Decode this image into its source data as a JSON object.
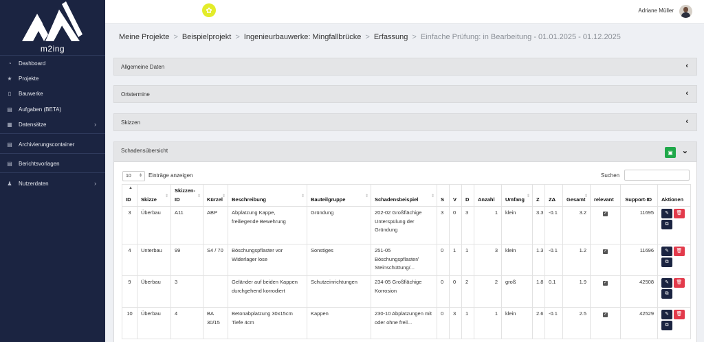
{
  "app": {
    "name": "m2ing"
  },
  "sidebar": {
    "items": [
      {
        "label": "Dashboard",
        "icon": "dashboard-icon"
      },
      {
        "label": "Projekte",
        "icon": "star-icon"
      },
      {
        "label": "Bauwerke",
        "icon": "building-icon"
      },
      {
        "label": "Aufgaben (BETA)",
        "icon": "tasks-icon"
      },
      {
        "label": "Datensätze",
        "icon": "records-icon",
        "has_submenu": true
      },
      {
        "label": "Archivierungscontainer",
        "icon": "archive-icon"
      },
      {
        "label": "Berichtsvorlagen",
        "icon": "report-icon"
      },
      {
        "label": "Nutzerdaten",
        "icon": "user-data-icon",
        "has_submenu": true
      }
    ]
  },
  "topbar": {
    "user_name": "Adriane Müller",
    "accent_color": "#e3ec2a"
  },
  "breadcrumb": {
    "items": [
      "Meine Projekte",
      "Beispielprojekt",
      "Ingenieurbauwerke: Mingfallbrücke",
      "Erfassung"
    ],
    "current": "Einfache Prüfung: in Bearbeitung - 01.01.2025 - 01.12.2025",
    "separator": ">"
  },
  "panels": {
    "allgemein": "Allgemeine Daten",
    "ortstermine": "Ortstermine",
    "skizzen": "Skizzen",
    "schaden": "Schadensübersicht"
  },
  "table_controls": {
    "page_length": "10",
    "length_label": "Einträge anzeigen",
    "search_label": "Suchen"
  },
  "table": {
    "headers": {
      "id": "ID",
      "skizze": "Skizze",
      "skizzen_id": "Skizzen-ID",
      "kuerzel": "Kürzel",
      "beschreibung": "Beschreibung",
      "bauteilgruppe": "Bauteilgruppe",
      "schadensbeispiel": "Schadensbeispiel",
      "s": "S",
      "v": "V",
      "d": "D",
      "anzahl": "Anzahl",
      "umfang": "Umfang",
      "z": "Z",
      "zdelta": "ZΔ",
      "gesamt": "Gesamt",
      "relevant": "relevant",
      "support_id": "Support-ID",
      "aktionen": "Aktionen"
    },
    "rows": [
      {
        "id": "3",
        "skizze": "Überbau",
        "skizzen_id": "A11",
        "kuerzel": "ABP",
        "beschreibung": "Abplatzung Kappe, freiliegende Bewehrung",
        "bauteilgruppe": "Gründung",
        "schadensbeispiel": "202-02 Großflächige Unterspülung der Gründung",
        "s": "3",
        "v": "0",
        "d": "3",
        "anzahl": "1",
        "umfang": "klein",
        "z": "3.3",
        "zdelta": "-0.1",
        "gesamt": "3.2",
        "relevant": true,
        "support_id": "11695"
      },
      {
        "id": "4",
        "skizze": "Unterbau",
        "skizzen_id": "99",
        "kuerzel": "S4 / 70",
        "beschreibung": "Böschungspflaster vor Widerlager lose",
        "bauteilgruppe": "Sonstiges",
        "schadensbeispiel": "251-05 Böschungspflaster/ Steinschüttung/...",
        "s": "0",
        "v": "1",
        "d": "1",
        "anzahl": "3",
        "umfang": "klein",
        "z": "1.3",
        "zdelta": "-0.1",
        "gesamt": "1.2",
        "relevant": true,
        "support_id": "11696"
      },
      {
        "id": "9",
        "skizze": "Überbau",
        "skizzen_id": "3",
        "kuerzel": "",
        "beschreibung": "Geländer auf beiden Kappen durchgehend korrodiert",
        "bauteilgruppe": "Schutzeinrichtungen",
        "schadensbeispiel": "234-05 Großflächige Korrosion",
        "s": "0",
        "v": "0",
        "d": "2",
        "anzahl": "2",
        "umfang": "groß",
        "z": "1.8",
        "zdelta": "0.1",
        "gesamt": "1.9",
        "relevant": true,
        "support_id": "42508"
      },
      {
        "id": "10",
        "skizze": "Überbau",
        "skizzen_id": "4",
        "kuerzel": "BA 30/15",
        "beschreibung": "Betonabplatzung 30x15cm Tiefe 4cm",
        "bauteilgruppe": "Kappen",
        "schadensbeispiel": "230-10 Abplatzungen mit oder ohne freil...",
        "s": "0",
        "v": "3",
        "d": "1",
        "anzahl": "1",
        "umfang": "klein",
        "z": "2.6",
        "zdelta": "-0.1",
        "gesamt": "2.5",
        "relevant": true,
        "support_id": "42529"
      }
    ]
  }
}
